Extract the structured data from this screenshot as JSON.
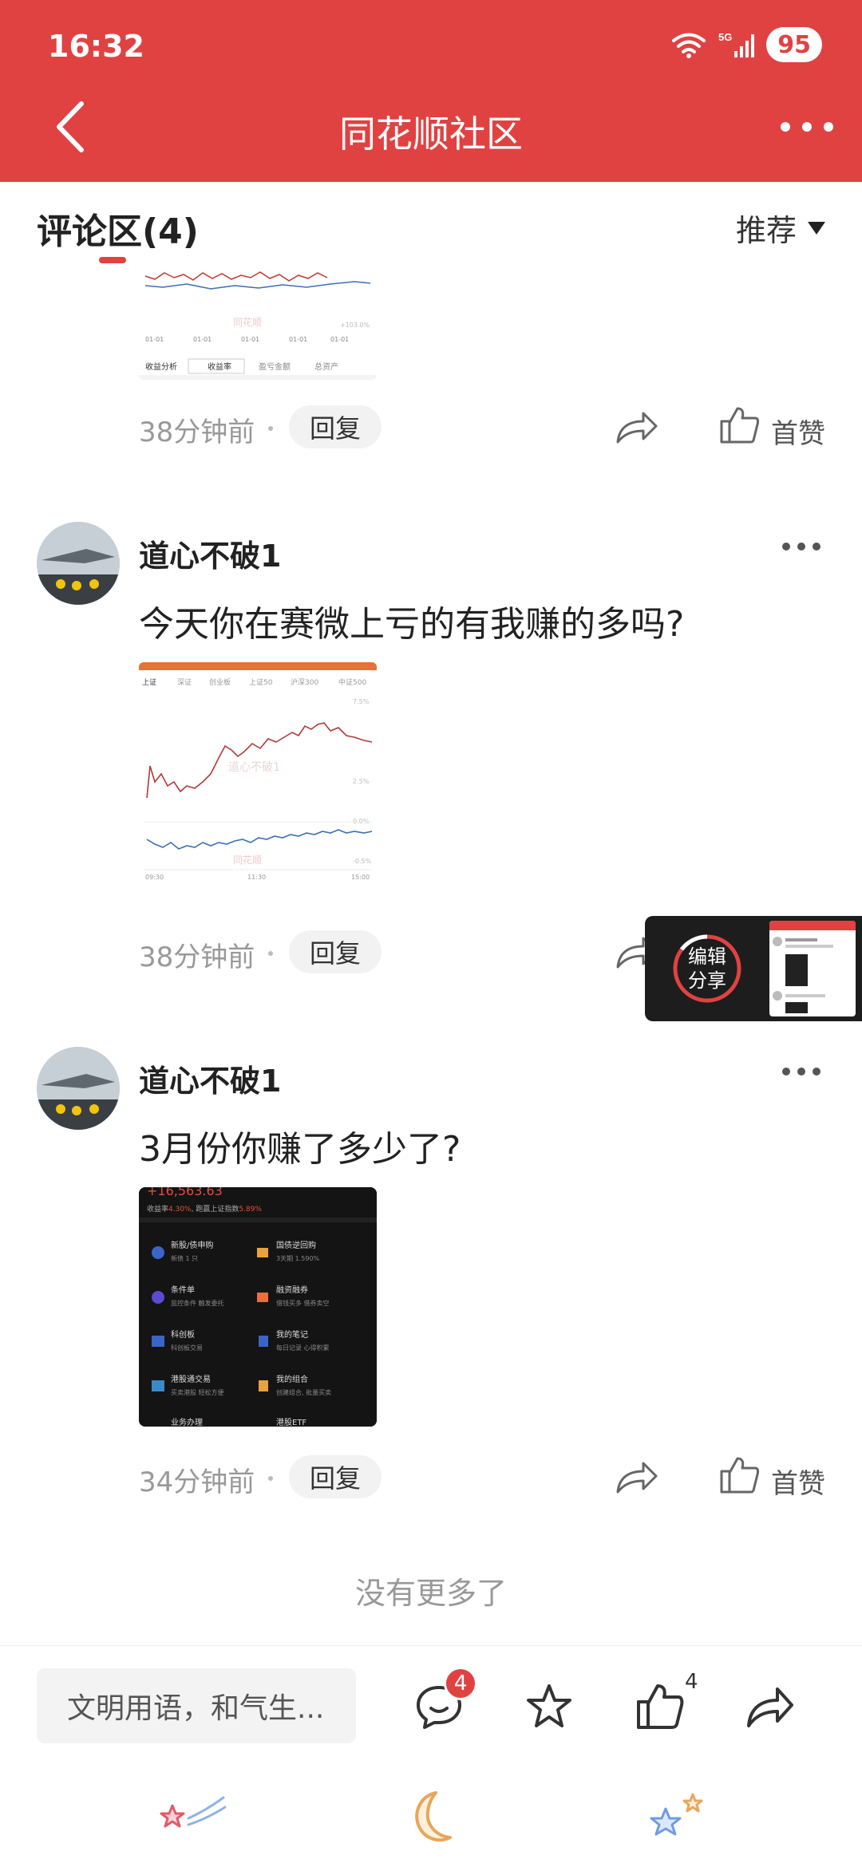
{
  "status": {
    "time": "16:32",
    "network": "5G",
    "battery": "95"
  },
  "header": {
    "title": "同花顺社区"
  },
  "section": {
    "title": "评论区(4)",
    "sort_label": "推荐"
  },
  "comments": [
    {
      "time": "38分钟前",
      "reply_label": "回复",
      "like_label": "首赞",
      "image": {
        "tabs": [
          "收益分析",
          "收益率",
          "盈亏金额",
          "总资产"
        ],
        "dates": [
          "01-01",
          "01-01",
          "01-01",
          "01-01",
          "01-01"
        ],
        "right_label": "+103.0%",
        "watermark": "同花顺"
      }
    },
    {
      "username": "道心不破1",
      "text": "今天你在赛微上亏的有我赚的多吗?",
      "time": "38分钟前",
      "reply_label": "回复",
      "image": {
        "indices": [
          "上证",
          "深证",
          "创业板",
          "上证50",
          "沪深300",
          "中证500"
        ],
        "y_labels": [
          "7.5%",
          "2.5%",
          "0.0%",
          "-0.5%"
        ],
        "x_labels": [
          "09:30",
          "11:30",
          "15:00"
        ],
        "watermark": "道心不破1",
        "brand": "同花顺"
      }
    },
    {
      "username": "道心不破1",
      "text": "3月份你赚了多少了?",
      "time": "34分钟前",
      "reply_label": "回复",
      "like_label": "首赞",
      "image": {
        "amount": "+16,563.63",
        "rate_line_prefix": "收益率",
        "rate": "4.30%",
        "rate_line_mid": ", 跑赢上证指数",
        "beat": "5.89%",
        "items": [
          {
            "title": "新股/债申购",
            "sub": "新债 1 只"
          },
          {
            "title": "国债逆回购",
            "sub": "3天期 1.590%"
          },
          {
            "title": "条件单",
            "sub": "监控条件 触发委托"
          },
          {
            "title": "融资融券",
            "sub": "借钱买多 借券卖空"
          },
          {
            "title": "科创板",
            "sub": "科创板交易"
          },
          {
            "title": "我的笔记",
            "sub": "每日记录 心得积累"
          },
          {
            "title": "港股通交易",
            "sub": "买卖港股 轻松方便"
          },
          {
            "title": "我的组合",
            "sub": "创建组合, 批量买卖"
          },
          {
            "title": "业务办理",
            "sub": ""
          },
          {
            "title": "港股ETF",
            "sub": ""
          }
        ]
      }
    }
  ],
  "footer": {
    "no_more": "没有更多了"
  },
  "float_panel": {
    "line1": "编辑",
    "line2": "分享"
  },
  "bottom": {
    "input_placeholder": "文明用语，和气生...",
    "comment_badge": "4",
    "like_count": "4"
  },
  "colors": {
    "brand_red": "#E04242",
    "text_dark": "#222222",
    "text_gray": "#999999"
  }
}
